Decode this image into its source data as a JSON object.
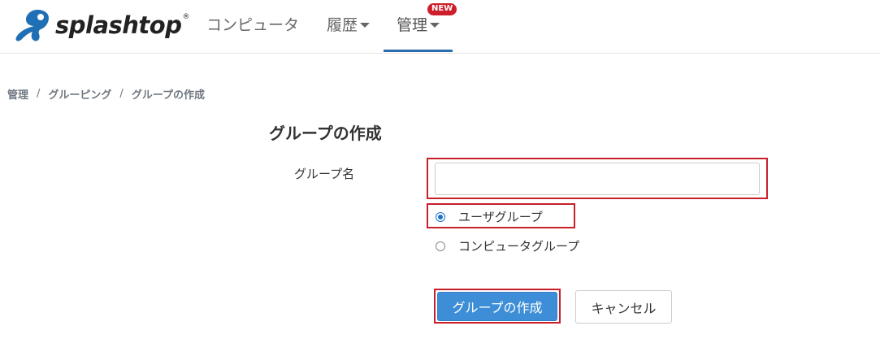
{
  "colors": {
    "brand_blue": "#2a6db0",
    "primary_button": "#3d8ed6",
    "badge_red": "#cc1f2b",
    "highlight_red": "#c8202a"
  },
  "header": {
    "logo_text": "splashtop",
    "logo_mark": "®",
    "nav": {
      "computers": "コンピュータ",
      "history": "履歴",
      "manage": "管理",
      "manage_badge": "NEW"
    }
  },
  "breadcrumb": {
    "items": [
      "管理",
      "グルーピング",
      "グループの作成"
    ],
    "separator": "/"
  },
  "form": {
    "title": "グループの作成",
    "group_name_label": "グループ名",
    "group_name_value": "",
    "group_name_placeholder": "",
    "group_type": {
      "options": [
        "ユーザグループ",
        "コンピュータグループ"
      ],
      "selected": "ユーザグループ"
    },
    "create_button": "グループの作成",
    "cancel_button": "キャンセル"
  }
}
